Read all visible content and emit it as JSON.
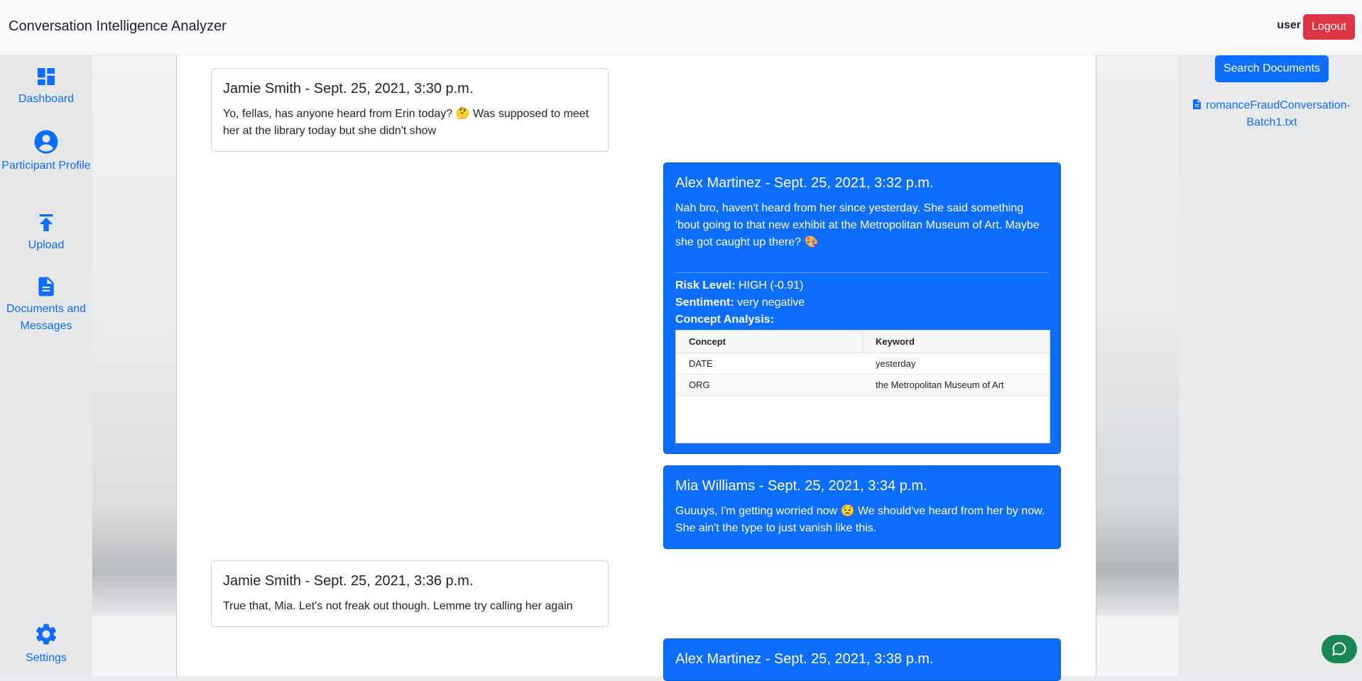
{
  "app": {
    "title": "Conversation Intelligence Analyzer"
  },
  "header": {
    "user_label": "user",
    "logout_label": "Logout"
  },
  "sidebar": {
    "items": [
      {
        "label": "Dashboard",
        "icon": "dashboard-icon"
      },
      {
        "label": "Participant Profile",
        "icon": "user-icon"
      },
      {
        "label": "Upload",
        "icon": "upload-icon"
      },
      {
        "label": "Documents and Messages",
        "icon": "document-icon"
      },
      {
        "label": "Settings",
        "icon": "gear-icon"
      }
    ]
  },
  "right_panel": {
    "search_label": "Search Documents",
    "documents": [
      {
        "name": "romanceFraudConversation-Batch1.txt",
        "icon": "file-icon"
      }
    ]
  },
  "messages": [
    {
      "header": "Jamie Smith - Sept. 25, 2021, 3:30 p.m.",
      "body": "Yo, fellas, has anyone heard from Erin today? 🤔 Was supposed to meet her at the library today but she didn't show",
      "side": "left"
    },
    {
      "header": "Alex Martinez - Sept. 25, 2021, 3:32 p.m.",
      "body": "Nah bro, haven't heard from her since yesterday. She said something 'bout going to that new exhibit at the Metropolitan Museum of Art. Maybe she got caught up there? 🎨",
      "side": "right",
      "analysis": {
        "risk_label": "Risk Level:",
        "risk_value": "HIGH (-0.91)",
        "sentiment_label": "Sentiment:",
        "sentiment_value": "very negative",
        "concept_label": "Concept Analysis:",
        "table": {
          "headers": [
            "Concept",
            "Keyword"
          ],
          "rows": [
            [
              "DATE",
              "yesterday"
            ],
            [
              "ORG",
              "the Metropolitan Museum of Art"
            ]
          ]
        }
      }
    },
    {
      "header": "Mia Williams - Sept. 25, 2021, 3:34 p.m.",
      "body": "Guuuys, I'm getting worried now 😟 We should've heard from her by now. She ain't the type to just vanish like this.",
      "side": "right"
    },
    {
      "header": "Jamie Smith - Sept. 25, 2021, 3:36 p.m.",
      "body": "True that, Mia. Let's not freak out though. Lemme try calling her again",
      "side": "left"
    },
    {
      "header": "Alex Martinez - Sept. 25, 2021, 3:38 p.m.",
      "body": "",
      "side": "right"
    }
  ],
  "colors": {
    "primary": "#0d6efd",
    "danger": "#dc3545",
    "success": "#198754"
  },
  "chat_fab": {
    "icon": "chat-icon"
  }
}
